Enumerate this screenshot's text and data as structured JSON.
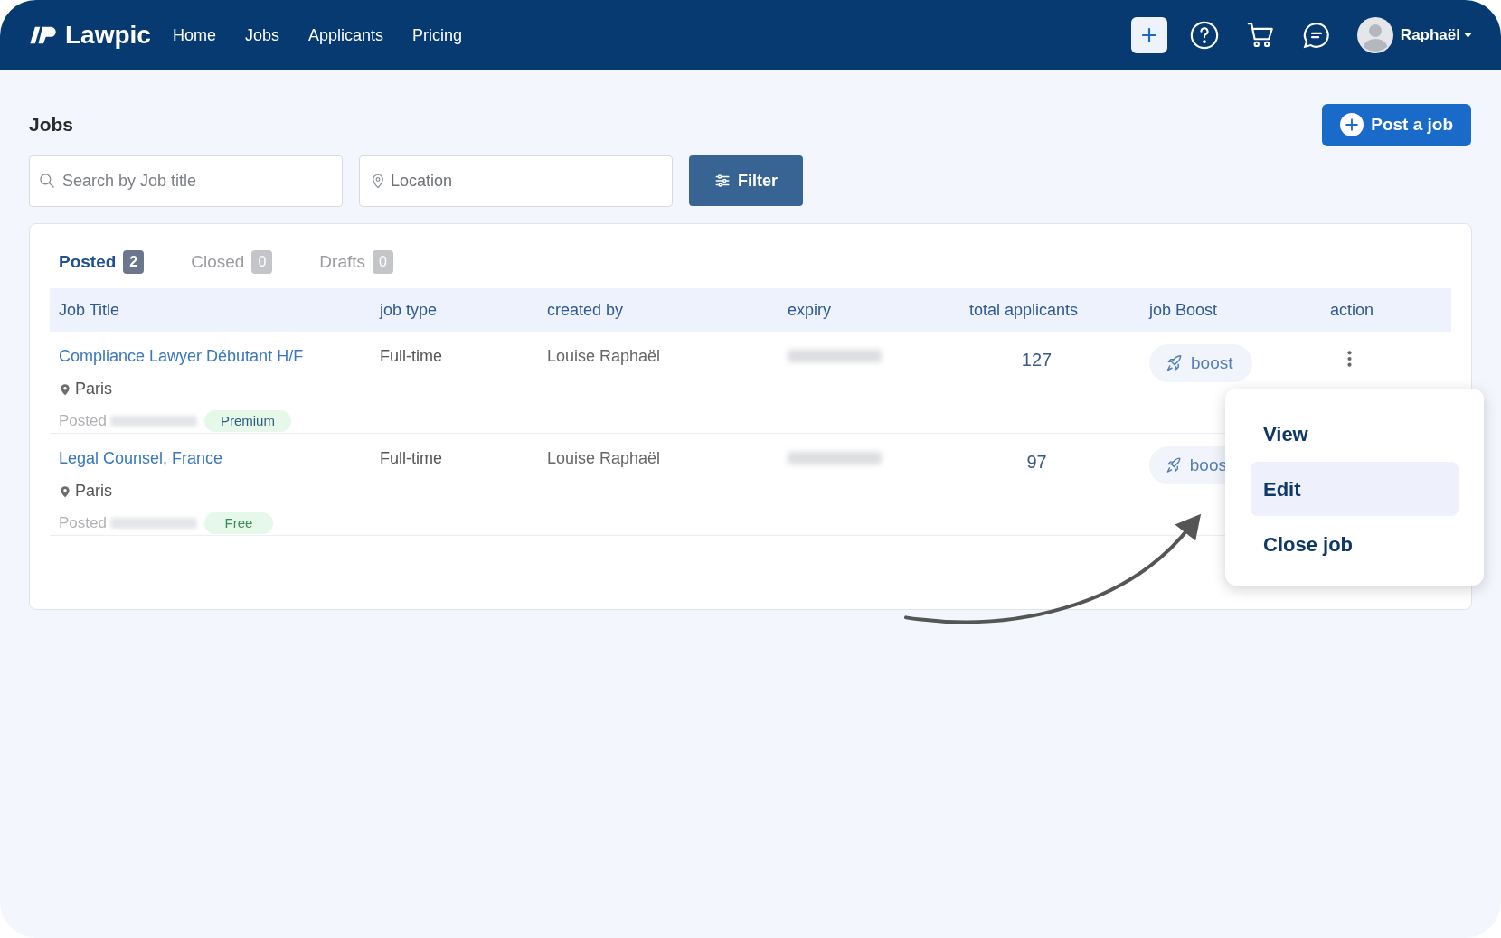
{
  "nav": {
    "brand": "Lawpic",
    "links": [
      "Home",
      "Jobs",
      "Applicants",
      "Pricing"
    ],
    "user": "Raphaël"
  },
  "page": {
    "title": "Jobs",
    "post_button": "Post a job"
  },
  "filters": {
    "search": {
      "placeholder": "Search by Job title"
    },
    "location": {
      "placeholder": "Location"
    },
    "button": "Filter"
  },
  "tabs": [
    {
      "label": "Posted",
      "count": "2",
      "selected": true
    },
    {
      "label": "Closed",
      "count": "0",
      "selected": false
    },
    {
      "label": "Drafts",
      "count": "0",
      "selected": false
    }
  ],
  "table": {
    "columns": [
      "Job Title",
      "job type",
      "created by",
      "expiry",
      "total applicants",
      "job Boost",
      "action"
    ],
    "rows": [
      {
        "title": "Compliance Lawyer Débutant H/F",
        "location": "Paris",
        "posted_label": "Posted",
        "plan": {
          "label": "Premium",
          "kind": "premium"
        },
        "job_type": "Full-time",
        "created_by": "Louise Raphaël",
        "applicants": "127",
        "boost": "boost"
      },
      {
        "title": "Legal Counsel, France",
        "location": "Paris",
        "posted_label": "Posted",
        "plan": {
          "label": "Free",
          "kind": "free"
        },
        "job_type": "Full-time",
        "created_by": "Louise Raphaël",
        "applicants": "97",
        "boost": "boos"
      }
    ]
  },
  "menu": [
    {
      "label": "View",
      "selected": false
    },
    {
      "label": "Edit",
      "selected": true
    },
    {
      "label": "Close job",
      "selected": false
    }
  ]
}
